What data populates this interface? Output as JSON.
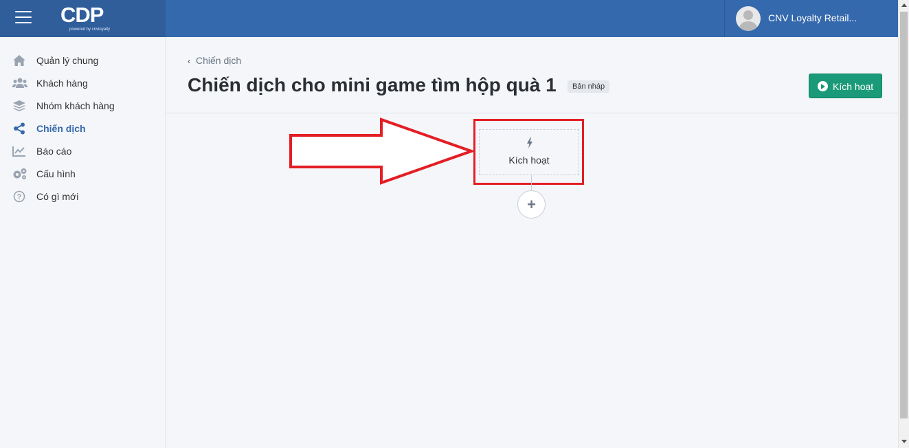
{
  "header": {
    "logo": "CDP",
    "logo_sub": "powered by cnvloyalty",
    "user_name": "CNV Loyalty Retail..."
  },
  "sidebar": {
    "items": [
      {
        "label": "Quản lý chung",
        "icon": "home-icon"
      },
      {
        "label": "Khách hàng",
        "icon": "users-icon"
      },
      {
        "label": "Nhóm khách hàng",
        "icon": "layers-icon"
      },
      {
        "label": "Chiến dịch",
        "icon": "share-icon",
        "active": true
      },
      {
        "label": "Báo cáo",
        "icon": "chart-icon"
      },
      {
        "label": "Cấu hình",
        "icon": "gears-icon"
      },
      {
        "label": "Có gì mới",
        "icon": "question-icon"
      }
    ]
  },
  "main": {
    "breadcrumb": "Chiến dịch",
    "title": "Chiến dịch cho mini game tìm hộp quà 1",
    "status": "Bản nháp",
    "activate_label": "Kích hoạt"
  },
  "canvas": {
    "trigger_label": "Kích hoạt",
    "add_symbol": "+"
  },
  "colors": {
    "brand": "#3569ad",
    "accent_green": "#1a9a78",
    "annotation_red": "#e31e24"
  }
}
